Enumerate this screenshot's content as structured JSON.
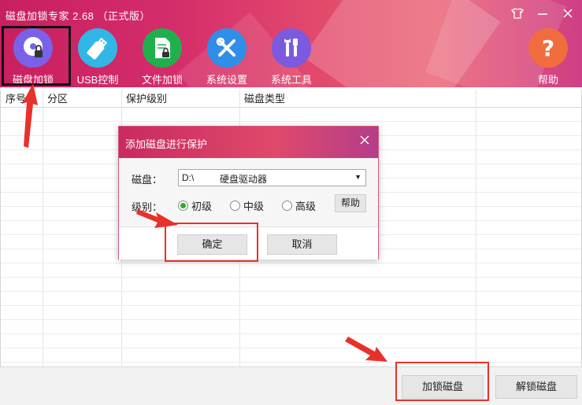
{
  "window": {
    "title": "磁盘加锁专家 2.68 （正式版）",
    "controls": [
      "skin-icon",
      "minimize-icon",
      "close-icon"
    ]
  },
  "toolbar": {
    "items": [
      {
        "label": "磁盘加锁",
        "icon": "disk-lock-icon",
        "color": "#7a62e8",
        "selected": true
      },
      {
        "label": "USB控制",
        "icon": "usb-drive-icon",
        "color": "#31b6e6"
      },
      {
        "label": "文件加锁",
        "icon": "file-lock-icon",
        "color": "#1fb04d"
      },
      {
        "label": "系统设置",
        "icon": "tools-icon",
        "color": "#2f8ee8"
      },
      {
        "label": "系统工具",
        "icon": "wrench-screwdriver-icon",
        "color": "#7b5ae0"
      }
    ],
    "help": {
      "label": "帮助",
      "icon": "question-icon",
      "color": "#f26d3d"
    }
  },
  "table": {
    "columns": [
      "序号",
      "分区",
      "保护级别",
      "磁盘类型"
    ],
    "rows": []
  },
  "dialog": {
    "title": "添加磁盘进行保护",
    "disk_label": "磁盘：",
    "disk_value_drive": "D:\\",
    "disk_value_type": "硬盘驱动器",
    "level_label": "级别：",
    "levels": [
      {
        "label": "初级",
        "checked": true
      },
      {
        "label": "中级",
        "checked": false
      },
      {
        "label": "高级",
        "checked": false
      }
    ],
    "help_button": "帮助",
    "ok_button": "确定",
    "cancel_button": "取消"
  },
  "footer": {
    "lock_button": "加锁磁盘",
    "unlock_button": "解锁磁盘"
  },
  "annotations": {
    "highlight_color": "#e8312b"
  }
}
